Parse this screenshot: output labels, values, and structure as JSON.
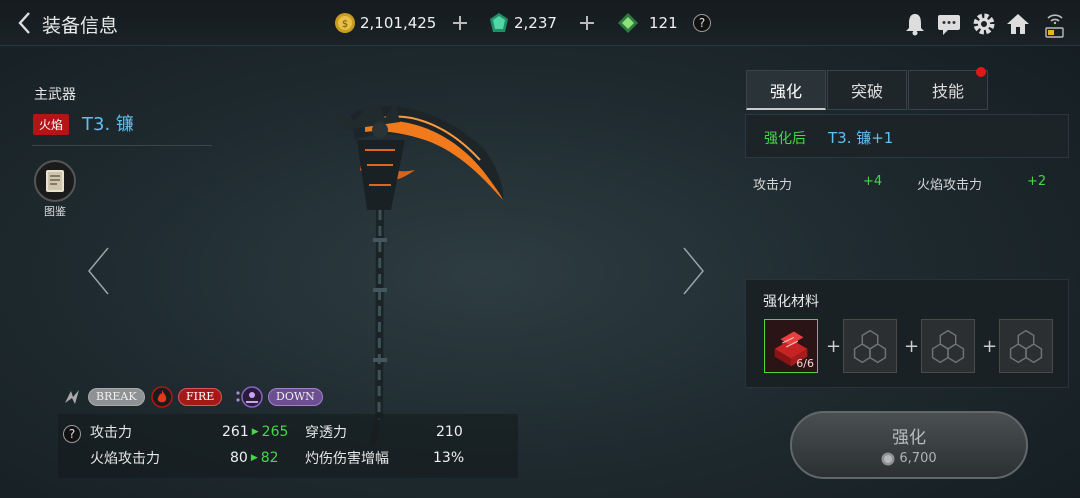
{
  "header": {
    "title": "装备信息",
    "gold": "2,101,425",
    "gem": "2,237",
    "token": "121",
    "help": "?"
  },
  "weapon": {
    "type_label": "主武器",
    "element_badge": "火焰",
    "name": "T3. 镰",
    "codex_label": "图鉴"
  },
  "tags": [
    "BREAK",
    "FIRE",
    "DOWN"
  ],
  "stats": [
    {
      "label": "攻击力",
      "value": "261",
      "new": "265",
      "label2": "穿透力",
      "value2": "210"
    },
    {
      "label": "火焰攻击力",
      "value": "80",
      "new": "82",
      "label2": "灼伤伤害增幅",
      "value2": "13%"
    }
  ],
  "tabs": [
    {
      "label": "强化",
      "active": true
    },
    {
      "label": "突破",
      "active": false
    },
    {
      "label": "技能",
      "active": false,
      "notify": true
    }
  ],
  "enhance": {
    "after_label": "强化后",
    "after_name": "T3. 镰+1",
    "bonus": [
      {
        "label": "攻击力",
        "value": "+4"
      },
      {
        "label": "火焰攻击力",
        "value": "+2"
      }
    ],
    "materials_title": "强化材料",
    "material_count": "6/6",
    "button_label": "强化",
    "cost": "6,700"
  },
  "colors": {
    "accent_blue": "#5fc0f2",
    "green": "#46d64a",
    "fire_red": "#b31515"
  },
  "icons": [
    "back-arrow-icon",
    "gold-coin-icon",
    "green-gem-icon",
    "token-icon",
    "bell-icon",
    "chat-icon",
    "gear-icon",
    "home-icon",
    "wifi-battery-icon",
    "book-icon"
  ]
}
